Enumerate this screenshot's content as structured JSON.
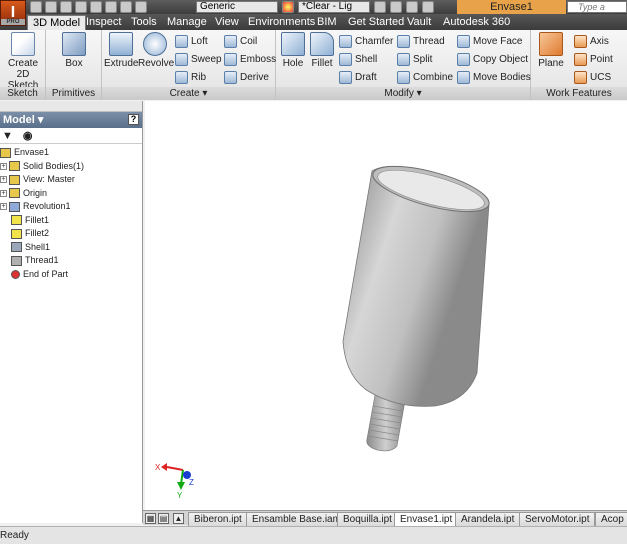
{
  "app": {
    "logo_letter": "I",
    "logo_sub": "PRO",
    "material": "Generic",
    "appearance": "*Clear - Lig",
    "title": "Envase1",
    "search_placeholder": "Type a keyword"
  },
  "tabs": [
    "3D Model",
    "Inspect",
    "Tools",
    "Manage",
    "View",
    "Environments",
    "BIM",
    "Get Started",
    "Vault",
    "Autodesk 360"
  ],
  "ribbon": {
    "sketch": {
      "button": "Create 2D Sketch",
      "title": "Sketch"
    },
    "primitives": {
      "button": "Box",
      "title": "Primitives"
    },
    "create": {
      "title": "Create",
      "big": [
        "Extrude",
        "Revolve"
      ],
      "small": [
        "Loft",
        "Coil",
        "Sweep",
        "Emboss",
        "Rib",
        "Derive"
      ]
    },
    "modify": {
      "title": "Modify",
      "big": [
        "Hole",
        "Fillet"
      ],
      "small": [
        "Chamfer",
        "Thread",
        "Move Face",
        "Shell",
        "Split",
        "Copy Object",
        "Draft",
        "Combine",
        "Move Bodies"
      ]
    },
    "work": {
      "title": "Work Features",
      "big": "Plane",
      "small": [
        "Axis",
        "Point",
        "UCS"
      ]
    }
  },
  "browser": {
    "title": "Model",
    "help": "?",
    "items": [
      {
        "label": "Envase1",
        "expand": ""
      },
      {
        "label": "Solid Bodies(1)",
        "expand": "+"
      },
      {
        "label": "View: Master",
        "expand": "+"
      },
      {
        "label": "Origin",
        "expand": "+"
      },
      {
        "label": "Revolution1",
        "expand": "+"
      },
      {
        "label": "Fillet1",
        "expand": ""
      },
      {
        "label": "Fillet2",
        "expand": ""
      },
      {
        "label": "Shell1",
        "expand": ""
      },
      {
        "label": "Thread1",
        "expand": ""
      },
      {
        "label": "End of Part",
        "expand": ""
      }
    ]
  },
  "triad": {
    "x": "X",
    "y": "Y",
    "z": "Z"
  },
  "doc_tabs": [
    "Biberon.ipt",
    "Ensamble Base.iam",
    "Boquilla.ipt",
    "Envase1.ipt",
    "Arandela.ipt",
    "ServoMotor.ipt",
    "Acop"
  ],
  "active_doc": "Envase1.ipt",
  "status": "Ready"
}
